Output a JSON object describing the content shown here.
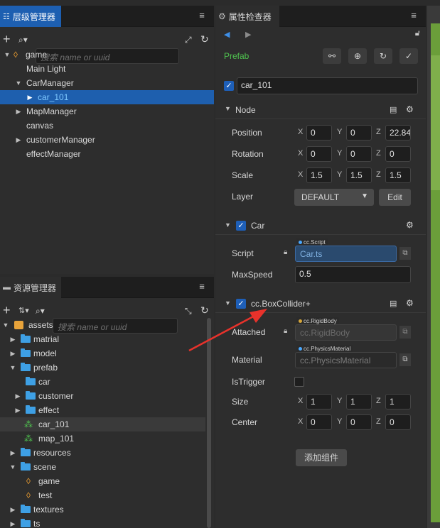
{
  "hierarchy": {
    "title": "层级管理器",
    "search_placeholder": "搜索 name or uuid",
    "nodes": [
      {
        "label": "game"
      },
      {
        "label": "Main Light"
      },
      {
        "label": "CarManager"
      },
      {
        "label": "car_101"
      },
      {
        "label": "MapManager"
      },
      {
        "label": "canvas"
      },
      {
        "label": "customerManager"
      },
      {
        "label": "effectManager"
      }
    ]
  },
  "assets": {
    "title": "资源管理器",
    "search_placeholder": "搜索 name or uuid",
    "items": [
      {
        "label": "assets"
      },
      {
        "label": "matrial"
      },
      {
        "label": "model"
      },
      {
        "label": "prefab"
      },
      {
        "label": "car"
      },
      {
        "label": "customer"
      },
      {
        "label": "effect"
      },
      {
        "label": "car_101"
      },
      {
        "label": "map_101"
      },
      {
        "label": "resources"
      },
      {
        "label": "scene"
      },
      {
        "label": "game"
      },
      {
        "label": "test"
      },
      {
        "label": "textures"
      },
      {
        "label": "ts"
      }
    ]
  },
  "inspector": {
    "title": "属性检查器",
    "prefab_label": "Prefab",
    "node_name": "car_101",
    "node_section": "Node",
    "position": {
      "label": "Position",
      "x": "0",
      "y": "0",
      "z": "22.84"
    },
    "rotation": {
      "label": "Rotation",
      "x": "0",
      "y": "0",
      "z": "0"
    },
    "scale": {
      "label": "Scale",
      "x": "1.5",
      "y": "1.5",
      "z": "1.5"
    },
    "layer": {
      "label": "Layer",
      "value": "DEFAULT",
      "edit": "Edit"
    },
    "car_section": "Car",
    "script": {
      "label": "Script",
      "tag": "cc.Script",
      "value": "Car.ts"
    },
    "maxspeed": {
      "label": "MaxSpeed",
      "value": "0.5"
    },
    "collider_section": "cc.BoxCollider+",
    "attached": {
      "label": "Attached",
      "tag": "cc.RigidBody",
      "value": "cc.RigidBody"
    },
    "material": {
      "label": "Material",
      "tag": "cc.PhysicsMaterial",
      "value": "cc.PhysicsMaterial"
    },
    "istrigger": {
      "label": "IsTrigger"
    },
    "size": {
      "label": "Size",
      "x": "1",
      "y": "1",
      "z": "1"
    },
    "center": {
      "label": "Center",
      "x": "0",
      "y": "0",
      "z": "0"
    },
    "add_component": "添加组件",
    "axis_x": "X",
    "axis_y": "Y",
    "axis_z": "Z"
  },
  "colors": {
    "accent": "#1e5fae",
    "prefab_green": "#4fc34f",
    "folder": "#3ea0e5",
    "annotation_arrow": "#e8322b"
  }
}
